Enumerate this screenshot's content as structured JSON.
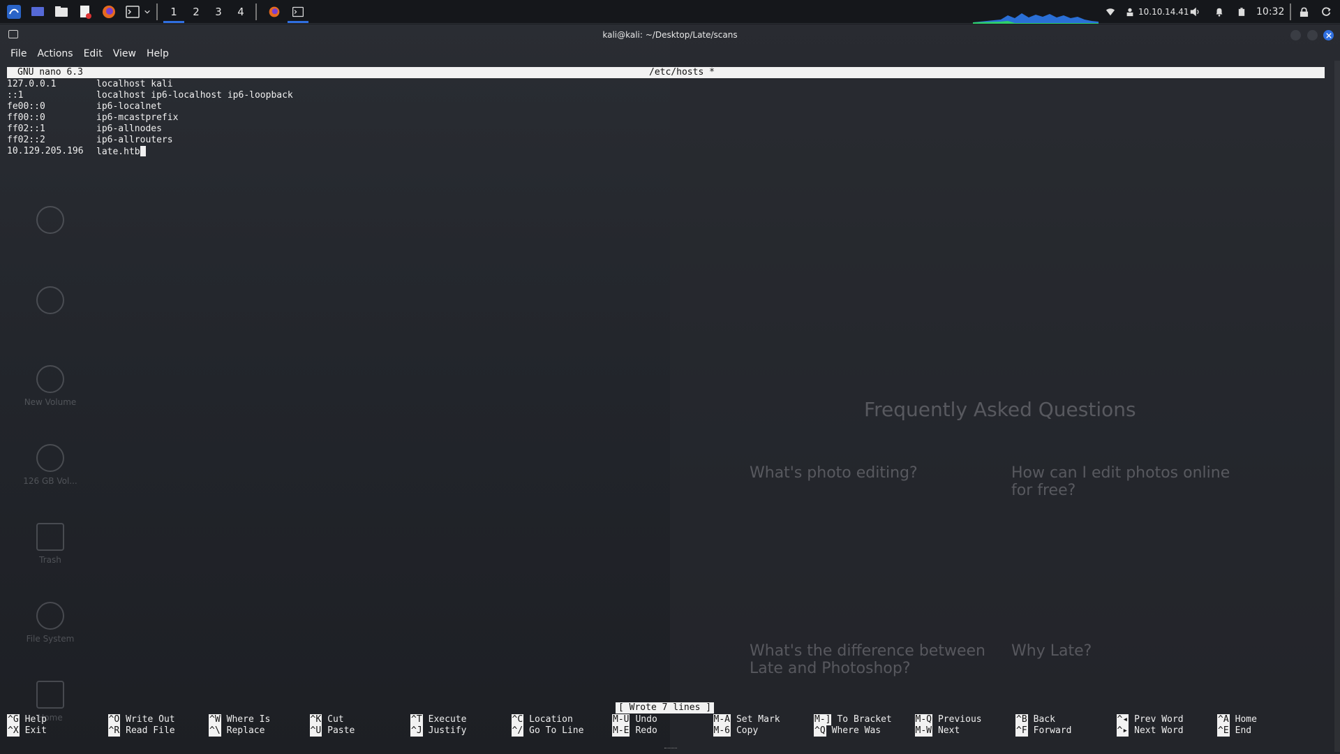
{
  "panel": {
    "workspaces": [
      "1",
      "2",
      "3",
      "4"
    ],
    "active_workspace": "1",
    "ip": "10.10.14.41",
    "clock": "10:32",
    "accent": "#2f6fe0"
  },
  "desktop": {
    "icons": [
      "New Volume",
      "126 GB Vol...",
      "Trash",
      "File System",
      "Home"
    ]
  },
  "background_page": {
    "faq_title": "Frequently Asked Questions",
    "q1": "What's photo editing?",
    "q2": "How can I edit photos online for free?",
    "q3": "What's the difference between Late and Photoshop?",
    "q4": "Why Late?"
  },
  "window": {
    "title": "kali@kali: ~/Desktop/Late/scans",
    "menu": [
      "File",
      "Actions",
      "Edit",
      "View",
      "Help"
    ]
  },
  "nano": {
    "version": "GNU nano 6.3",
    "filename": "/etc/hosts *",
    "lines": [
      {
        "ip": "127.0.0.1",
        "host": "localhost kali"
      },
      {
        "ip": "::1",
        "host": "localhost ip6-localhost ip6-loopback"
      },
      {
        "ip": "fe00::0",
        "host": "ip6-localnet"
      },
      {
        "ip": "ff00::0",
        "host": "ip6-mcastprefix"
      },
      {
        "ip": "ff02::1",
        "host": "ip6-allnodes"
      },
      {
        "ip": "ff02::2",
        "host": "ip6-allrouters"
      },
      {
        "ip": "10.129.205.196",
        "host": "late.htb"
      }
    ],
    "status": "[ Wrote 7 lines ]",
    "shortcuts": [
      {
        "k1": "^G",
        "l1": "Help",
        "k2": "^X",
        "l2": "Exit"
      },
      {
        "k1": "^O",
        "l1": "Write Out",
        "k2": "^R",
        "l2": "Read File"
      },
      {
        "k1": "^W",
        "l1": "Where Is",
        "k2": "^\\",
        "l2": "Replace"
      },
      {
        "k1": "^K",
        "l1": "Cut",
        "k2": "^U",
        "l2": "Paste"
      },
      {
        "k1": "^T",
        "l1": "Execute",
        "k2": "^J",
        "l2": "Justify"
      },
      {
        "k1": "^C",
        "l1": "Location",
        "k2": "^/",
        "l2": "Go To Line"
      },
      {
        "k1": "M-U",
        "l1": "Undo",
        "k2": "M-E",
        "l2": "Redo"
      },
      {
        "k1": "M-A",
        "l1": "Set Mark",
        "k2": "M-6",
        "l2": "Copy"
      },
      {
        "k1": "M-]",
        "l1": "To Bracket",
        "k2": "^Q",
        "l2": "Where Was"
      },
      {
        "k1": "M-Q",
        "l1": "Previous",
        "k2": "M-W",
        "l2": "Next"
      },
      {
        "k1": "^B",
        "l1": "Back",
        "k2": "^F",
        "l2": "Forward"
      },
      {
        "k1": "^◂",
        "l1": "Prev Word",
        "k2": "^▸",
        "l2": "Next Word"
      },
      {
        "k1": "^A",
        "l1": "Home",
        "k2": "^E",
        "l2": "End"
      }
    ]
  }
}
